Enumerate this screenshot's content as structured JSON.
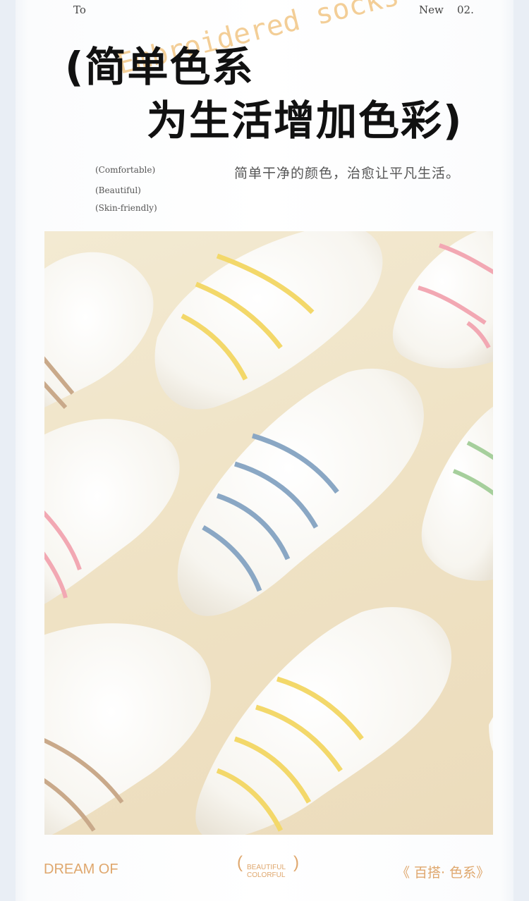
{
  "header": {
    "left_text": "To",
    "right_text": "New",
    "number": "02."
  },
  "headline": {
    "line1": "(简单色系",
    "line2": "为生活增加色彩)",
    "overlay_text": "Embroidered socks that"
  },
  "tags": [
    "(Comfortable)",
    "(Beautiful)",
    "(Skin-friendly)"
  ],
  "subtitle": "简单干净的颜色，治愈让平凡生活。",
  "photo": {
    "subject": "white ankle socks with colored stripes",
    "stripe_colors": [
      "#f3d86a",
      "#8aa7c4",
      "#f2a8b3",
      "#a6cf9c",
      "#c9a98a"
    ]
  },
  "footer": {
    "left": "DREAM OF",
    "middle_line1": "BEAUTIFUL",
    "middle_line2": "COLORFUL",
    "right": "《 百搭· 色系》"
  },
  "colors": {
    "accent": "#dfa76d",
    "overlay": "#f2c98c",
    "text": "#111111",
    "background": "#f4f6fa"
  }
}
